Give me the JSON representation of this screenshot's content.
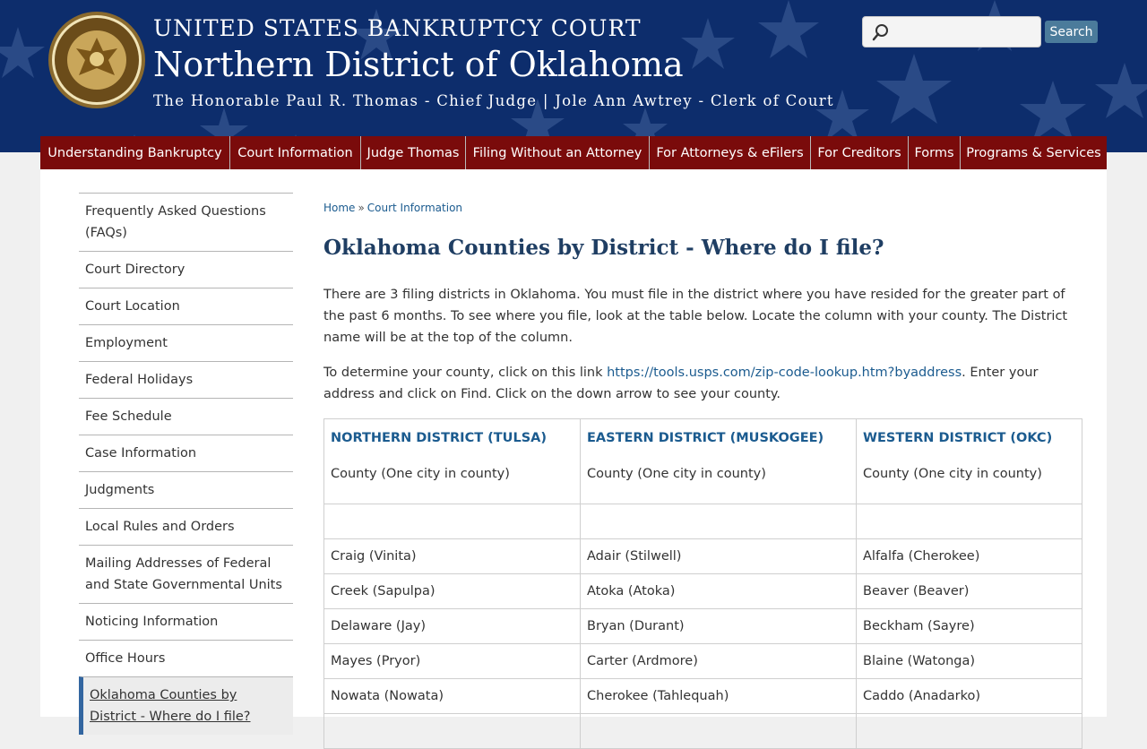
{
  "header": {
    "court_name": "UNITED STATES BANKRUPTCY COURT",
    "district_name": "Northern District of Oklahoma",
    "officials": "The Honorable Paul R. Thomas - Chief Judge | Jole Ann Awtrey - Clerk of Court",
    "seal_icon": "court-seal-icon",
    "search": {
      "placeholder": "",
      "button_label": "Search"
    }
  },
  "nav": {
    "items": [
      {
        "label": "Understanding Bankruptcy"
      },
      {
        "label": "Court Information"
      },
      {
        "label": "Judge Thomas"
      },
      {
        "label": "Filing Without an Attorney"
      },
      {
        "label": "For Attorneys & eFilers"
      },
      {
        "label": "For Creditors"
      },
      {
        "label": "Forms"
      },
      {
        "label": "Programs & Services"
      }
    ]
  },
  "sidebar": {
    "items": [
      {
        "label": "Frequently Asked Questions (FAQs)"
      },
      {
        "label": "Court Directory"
      },
      {
        "label": "Court Location"
      },
      {
        "label": "Employment"
      },
      {
        "label": "Federal Holidays"
      },
      {
        "label": "Fee Schedule"
      },
      {
        "label": "Case Information"
      },
      {
        "label": "Judgments"
      },
      {
        "label": "Local Rules and Orders"
      },
      {
        "label": "Mailing Addresses of Federal and State Governmental Units"
      },
      {
        "label": "Noticing Information"
      },
      {
        "label": "Office Hours"
      },
      {
        "label": "Oklahoma Counties by District - Where do I file?"
      }
    ]
  },
  "breadcrumb": {
    "home": "Home",
    "separator": "»",
    "current": "Court Information"
  },
  "page": {
    "title": "Oklahoma Counties by District - Where do I file?",
    "intro": "There are 3 filing districts in Oklahoma. You must file in the district where you have resided for the greater part of the past 6 months. To see where you file, look at the table below. Locate the column with your county. The District name will be at the top of the column.",
    "lookup_prefix": "To determine your county, click on this link ",
    "lookup_link": "https://tools.usps.com/zip-code-lookup.htm?byaddress",
    "lookup_suffix": ". Enter your address and click on Find. Click on the down arrow to see your county."
  },
  "table": {
    "headers": [
      {
        "district": "NORTHERN DISTRICT (TULSA)",
        "sub": "County (One city in county)"
      },
      {
        "district": "EASTERN DISTRICT (MUSKOGEE)",
        "sub": "County (One city in county)"
      },
      {
        "district": "WESTERN DISTRICT (OKC)",
        "sub": "County (One city in county)"
      }
    ],
    "rows": [
      [
        "Craig (Vinita)",
        "Adair (Stilwell)",
        "Alfalfa (Cherokee)"
      ],
      [
        "Creek (Sapulpa)",
        "Atoka (Atoka)",
        "Beaver (Beaver)"
      ],
      [
        "Delaware (Jay)",
        "Bryan (Durant)",
        "Beckham (Sayre)"
      ],
      [
        "Mayes (Pryor)",
        "Carter (Ardmore)",
        "Blaine (Watonga)"
      ],
      [
        "Nowata (Nowata)",
        "Cherokee (Tahlequah)",
        "Caddo (Anadarko)"
      ]
    ]
  },
  "colors": {
    "header_bg": "#0d2d6c",
    "nav_bg": "#7a0b0b",
    "link": "#1b5b8f",
    "title": "#1f3e63",
    "active_border": "#3366a0"
  }
}
